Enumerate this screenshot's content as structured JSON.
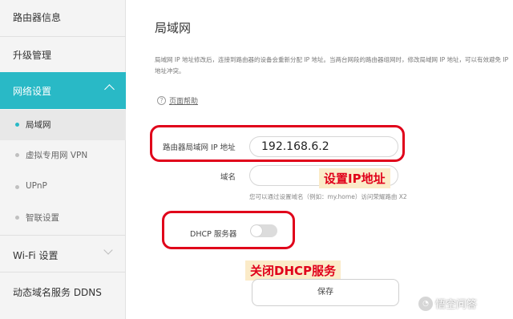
{
  "sidebar": {
    "router_info": "路由器信息",
    "upgrade": "升级管理",
    "network": "网络设置",
    "sub_items": [
      "局域网",
      "虚拟专用网 VPN",
      "UPnP",
      "智联设置"
    ],
    "wifi": "Wi-Fi 设置",
    "ddns": "动态域名服务 DDNS"
  },
  "main": {
    "title": "局域网",
    "description": "局域网 IP 地址修改后，连接到路由器的设备会重新分配 IP 地址。当两台网段的路由器组网时，修改局域网 IP 地址，可以有效避免 IP 地址冲突。",
    "help_icon": "?",
    "help_link": "页面帮助",
    "ip_label": "路由器局域网 IP 地址",
    "ip_value": "192.168.6.2",
    "domain_label": "域名",
    "domain_value": "",
    "domain_hint": "您可以通过设置域名（例如：my.home）访问荣耀路由 X2",
    "dhcp_label": "DHCP 服务器",
    "dhcp_enabled": false,
    "save_label": "保存"
  },
  "annotations": {
    "set_ip": "设置IP地址",
    "close_dhcp": "关闭DHCP服务"
  },
  "watermark": "悟空问答",
  "colors": {
    "accent": "#29b9c6",
    "highlight_border": "#e0001a",
    "callout_bg": "#fbebc8"
  }
}
